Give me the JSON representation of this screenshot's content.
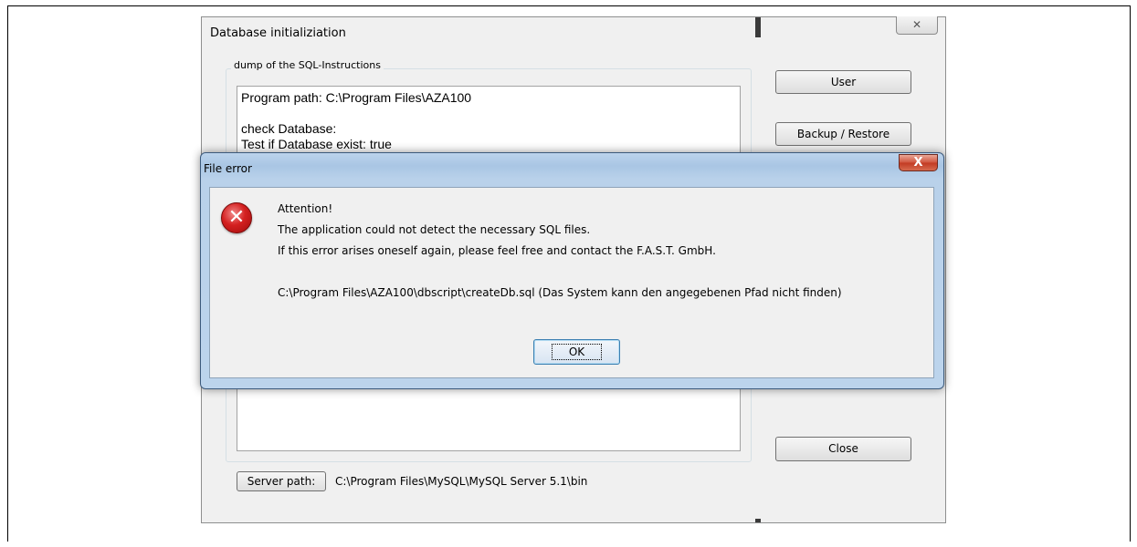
{
  "background_window": {
    "title": "Database initializiation",
    "close_symbol": "✕",
    "group_label": "dump of the SQL-Instructions",
    "log_lines": [
      "Program path: C:\\Program Files\\AZA100",
      "",
      "check Database:",
      "Test if Database exist: true"
    ],
    "buttons": {
      "user": "User",
      "backup": "Backup / Restore",
      "close": "Close"
    },
    "server_button": "Server path:",
    "server_path": "C:\\Program Files\\MySQL\\MySQL Server 5.1\\bin"
  },
  "dialog": {
    "title": "File error",
    "close_symbol": "X",
    "icon": "error-icon",
    "icon_glyph": "✕",
    "lines": [
      "Attention!",
      "The application could not detect the necessary SQL files.",
      "If this error arises oneself again, please feel free and contact the F.A.S.T. GmbH.",
      "C:\\Program Files\\AZA100\\dbscript\\createDb.sql (Das System kann den angegebenen Pfad nicht finden)"
    ],
    "ok_label": "OK"
  },
  "colors": {
    "dialog_frame": "#b9d1ea",
    "close_red": "#c23a22",
    "error_red": "#d42020"
  }
}
